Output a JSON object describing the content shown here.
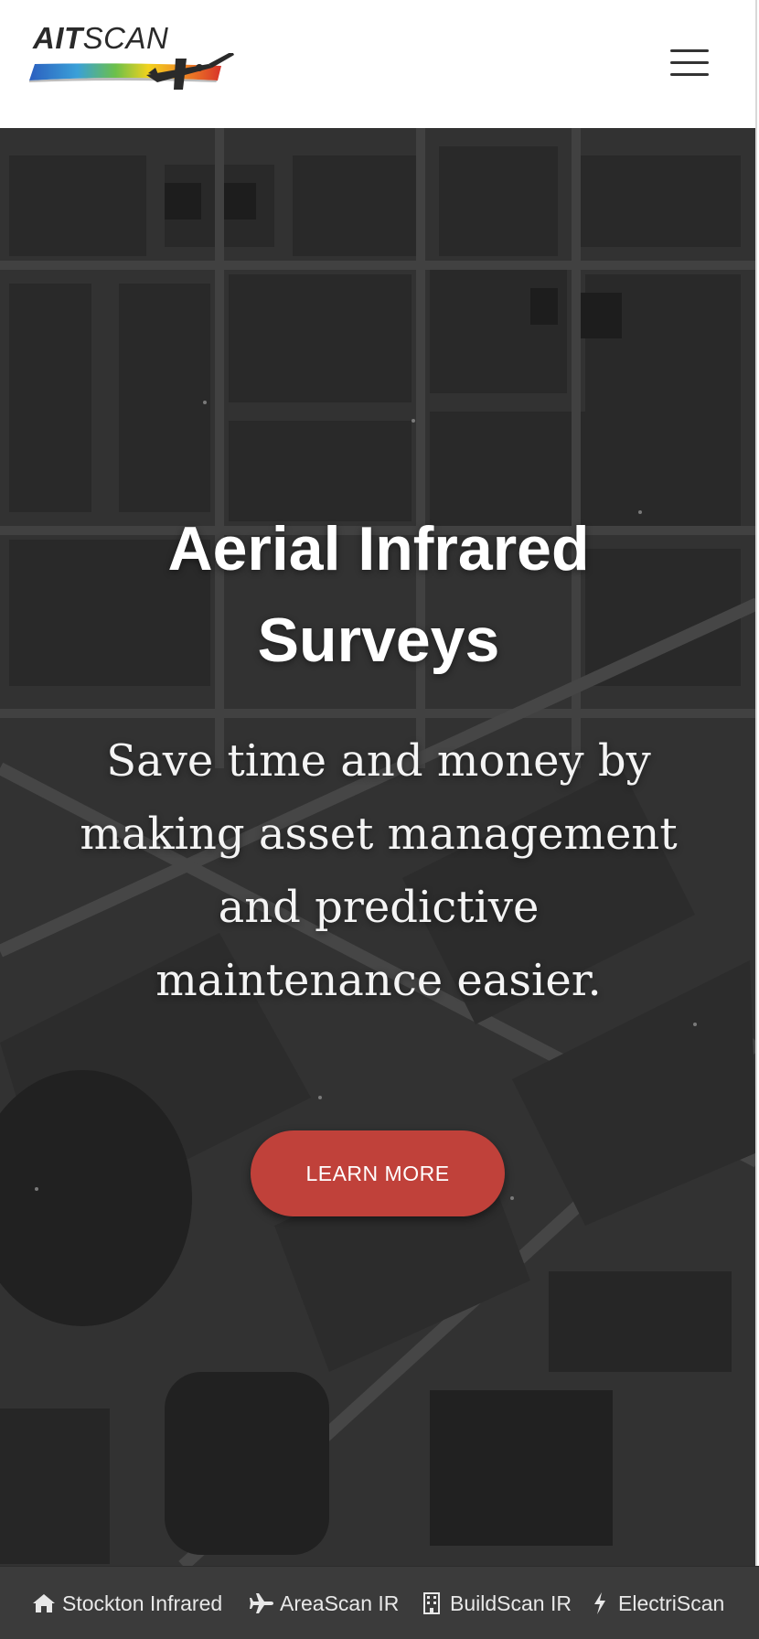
{
  "header": {
    "logo_text_bold": "AIT",
    "logo_text_rest": "SCAN",
    "menu_icon": "hamburger-menu-icon"
  },
  "hero": {
    "title": "Aerial Infrared Surveys",
    "subtitle": "Save time and money by making asset management and predictive maintenance easier.",
    "cta_label": "LEARN MORE",
    "cta_color": "#c0413a"
  },
  "bottom_nav": {
    "items": [
      {
        "label": "Stockton Infrared",
        "icon": "home-icon"
      },
      {
        "label": "AreaScan IR",
        "icon": "plane-icon"
      },
      {
        "label": "BuildScan IR",
        "icon": "building-icon"
      },
      {
        "label": "ElectriScan",
        "icon": "bolt-icon"
      }
    ]
  },
  "colors": {
    "header_bg": "#ffffff",
    "hero_overlay": "#3c3c3c",
    "bottom_bar_bg": "#3b3b3b",
    "text_light": "#ffffff"
  }
}
